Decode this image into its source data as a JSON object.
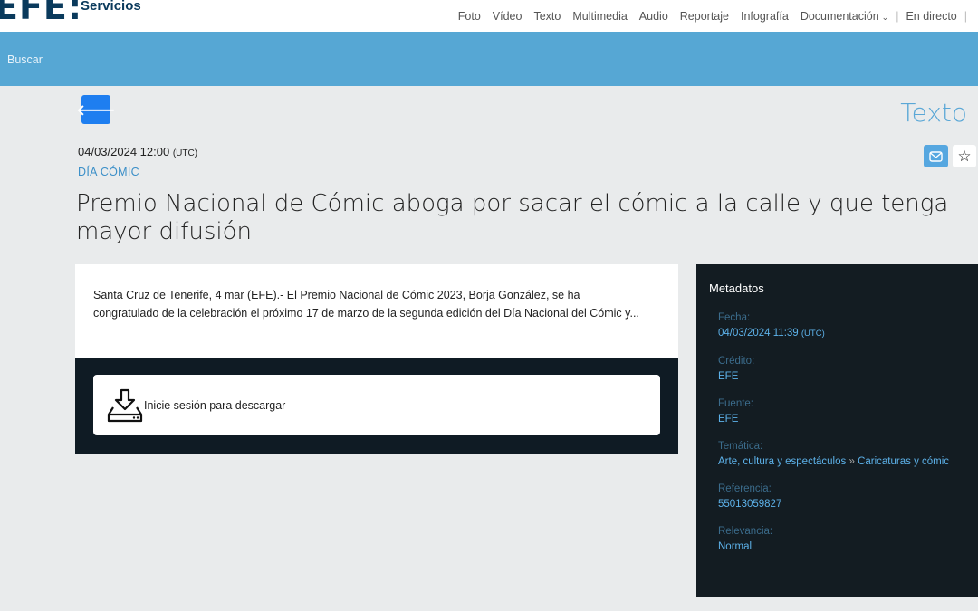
{
  "header": {
    "logo": "EFE:",
    "subtitle": "Servicios",
    "nav": [
      "Foto",
      "Vídeo",
      "Texto",
      "Multimedia",
      "Audio",
      "Reportaje",
      "Infografía",
      "Documentación",
      "En directo"
    ]
  },
  "search": {
    "label": "Buscar"
  },
  "article": {
    "type_label": "Texto",
    "date": "04/03/2024 12:00",
    "date_tz": "(UTC)",
    "category": "DÍA CÓMIC",
    "headline": "Premio Nacional de Cómic aboga por sacar el cómic a la calle y que tenga mayor difusión",
    "body": "Santa Cruz de Tenerife, 4 mar (EFE).- El Premio Nacional de Cómic 2023, Borja González, se ha congratulado de la celebración el próximo 17 de marzo de la segunda edición del Día Nacional del Cómic y...",
    "download_label": "Inicie sesión para descargar"
  },
  "metadata": {
    "title": "Metadatos",
    "fecha_key": "Fecha:",
    "fecha_val": "04/03/2024 11:39",
    "fecha_tz": "(UTC)",
    "credito_key": "Crédito:",
    "credito_val": "EFE",
    "fuente_key": "Fuente:",
    "fuente_val": "EFE",
    "tematica_key": "Temática:",
    "tematica_val1": "Arte, cultura y espectáculos",
    "tematica_sep": "»",
    "tematica_val2": "Caricaturas y cómic",
    "referencia_key": "Referencia:",
    "referencia_val": "55013059827",
    "relevancia_key": "Relevancia:",
    "relevancia_val": "Normal"
  },
  "icons": {
    "back": "arrow-left-icon",
    "mail": "envelope-icon",
    "star": "star-icon",
    "download": "download-icon"
  },
  "colors": {
    "accent": "#1e7ef0",
    "search_bar": "#56a7d4",
    "meta_bg": "#131c22",
    "link": "#5db2ea"
  }
}
